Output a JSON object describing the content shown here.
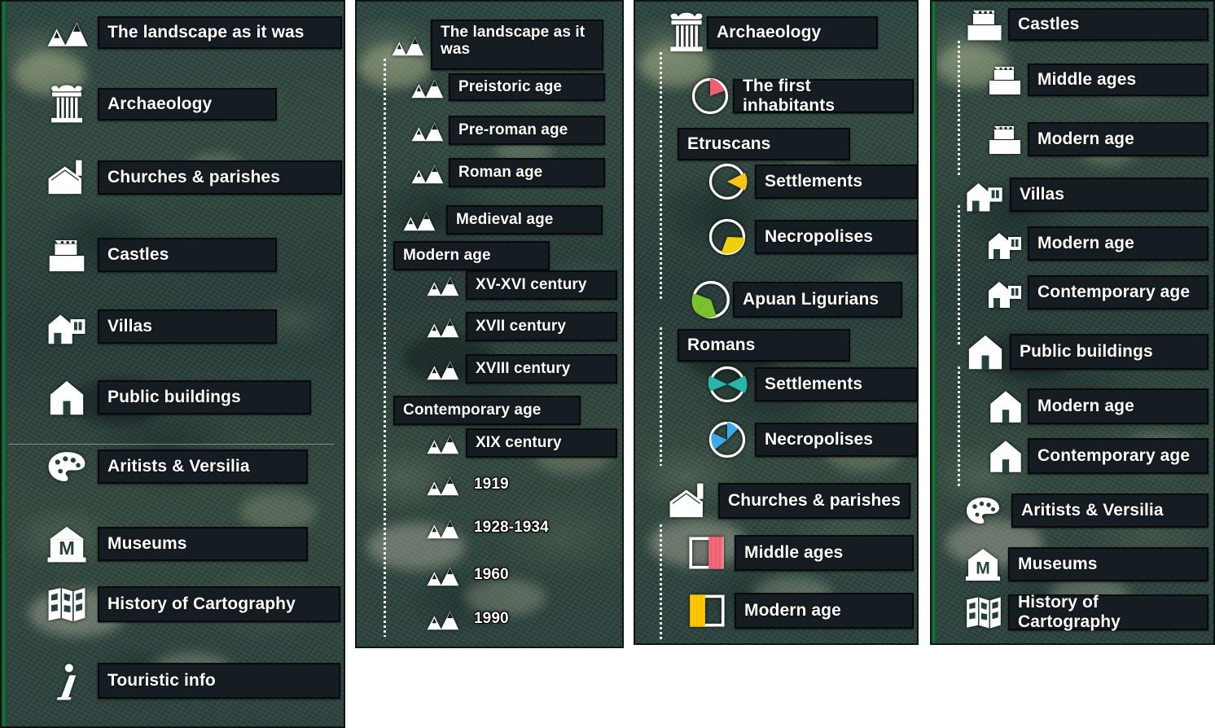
{
  "meta": {
    "title": "Thematic map legend panels",
    "panel_count": 4,
    "colors": {
      "label_background": "#161d22",
      "label_border": "#070a0c",
      "label_text": "#ffffff",
      "panel_background": "#2d4440",
      "green_edge": "#1b7a3a",
      "pie_pink": "#ef5f73",
      "pie_yellow": "#f5c518",
      "pie_yellow2": "#f0d00c",
      "pie_green": "#7ac22b",
      "pie_teal": "#26b5a6",
      "pie_blue": "#3fa9e8",
      "square_pink": "#f2697a",
      "square_yellow": "#fcc800"
    }
  },
  "panels": [
    {
      "id": "panel-main-themes",
      "name": "main-themes",
      "rows": [
        {
          "label": "The landscape as it was",
          "icon": "mountains-icon",
          "indent": 0,
          "box": true
        },
        {
          "label": "Archaeology",
          "icon": "column-icon",
          "indent": 0,
          "box": true
        },
        {
          "label": "Churches & parishes",
          "icon": "church-icon",
          "indent": 0,
          "box": true
        },
        {
          "label": "Castles",
          "icon": "castle-icon",
          "indent": 0,
          "box": true
        },
        {
          "label": "Villas",
          "icon": "villa-icon",
          "indent": 0,
          "box": true
        },
        {
          "label": "Public buildings",
          "icon": "public-building-icon",
          "indent": 0,
          "box": true
        },
        {
          "label": "Aritists & Versilia",
          "icon": "palette-icon",
          "indent": 0,
          "box": true
        },
        {
          "label": "Museums",
          "icon": "museum-icon",
          "indent": 0,
          "box": true
        },
        {
          "label": "History of Cartography",
          "icon": "map-icon",
          "indent": 0,
          "box": true
        },
        {
          "label": "Touristic info",
          "icon": "info-icon",
          "indent": 0,
          "box": true
        }
      ],
      "has_divider": true,
      "has_green_edge": true
    },
    {
      "id": "panel-landscape",
      "name": "landscape-as-it-was",
      "rows": [
        {
          "label": "The landscape as it was",
          "icon": "mountains-icon",
          "indent": 0,
          "box": true
        },
        {
          "label": "Preistoric age",
          "icon": "mountains-icon",
          "indent": 1,
          "box": true
        },
        {
          "label": "Pre-roman age",
          "icon": "mountains-icon",
          "indent": 1,
          "box": true
        },
        {
          "label": "Roman age",
          "icon": "mountains-icon",
          "indent": 1,
          "box": true
        },
        {
          "label": "Medieval age",
          "icon": "mountains-icon",
          "indent": 1,
          "box": true
        },
        {
          "label": "Modern age",
          "icon": "none",
          "indent": 0,
          "box": true
        },
        {
          "label": "XV-XVI century",
          "icon": "mountains-icon",
          "indent": 2,
          "box": true
        },
        {
          "label": "XVII century",
          "icon": "mountains-icon",
          "indent": 2,
          "box": true
        },
        {
          "label": "XVIII century",
          "icon": "mountains-icon",
          "indent": 2,
          "box": true
        },
        {
          "label": "Contemporary age",
          "icon": "none",
          "indent": 0,
          "box": true
        },
        {
          "label": "XIX century",
          "icon": "mountains-icon",
          "indent": 2,
          "box": true
        },
        {
          "label": "1919",
          "icon": "mountains-icon",
          "indent": 2,
          "box": false
        },
        {
          "label": "1928-1934",
          "icon": "mountains-icon",
          "indent": 2,
          "box": false
        },
        {
          "label": "1960",
          "icon": "mountains-icon",
          "indent": 2,
          "box": false
        },
        {
          "label": "1990",
          "icon": "mountains-icon",
          "indent": 2,
          "box": false
        }
      ],
      "has_divider": false,
      "has_green_edge": false
    },
    {
      "id": "panel-archaeology",
      "name": "archaeology",
      "rows": [
        {
          "label": "Archaeology",
          "icon": "column-icon",
          "indent": 0,
          "box": true
        },
        {
          "label": "The first inhabitants",
          "icon": "pie-pink-icon",
          "indent": 1,
          "box": true
        },
        {
          "label": "Etruscans",
          "icon": "none",
          "indent": 0,
          "box": true
        },
        {
          "label": "Settlements",
          "icon": "pie-yellow-icon",
          "indent": 2,
          "box": true
        },
        {
          "label": "Necropolises",
          "icon": "pie-yellow2-icon",
          "indent": 2,
          "box": true
        },
        {
          "label": "Apuan Ligurians",
          "icon": "pie-green-icon",
          "indent": 1,
          "box": true
        },
        {
          "label": "Romans",
          "icon": "none",
          "indent": 0,
          "box": true
        },
        {
          "label": "Settlements",
          "icon": "pie-teal-icon",
          "indent": 2,
          "box": true
        },
        {
          "label": "Necropolises",
          "icon": "pie-blue-icon",
          "indent": 2,
          "box": true
        },
        {
          "label": "Churches & parishes",
          "icon": "church-icon",
          "indent": 0,
          "box": true
        },
        {
          "label": "Middle ages",
          "icon": "square-pink-icon",
          "indent": 1,
          "box": true
        },
        {
          "label": "Modern age",
          "icon": "square-yellow-icon",
          "indent": 1,
          "box": true
        }
      ],
      "has_divider": false,
      "has_green_edge": false
    },
    {
      "id": "panel-buildings",
      "name": "buildings-and-culture",
      "rows": [
        {
          "label": "Castles",
          "icon": "castle-icon",
          "indent": 0,
          "box": true
        },
        {
          "label": "Middle ages",
          "icon": "castle-icon",
          "indent": 1,
          "box": true
        },
        {
          "label": "Modern age",
          "icon": "castle-icon",
          "indent": 1,
          "box": true
        },
        {
          "label": "Villas",
          "icon": "villa-icon",
          "indent": 0,
          "box": true
        },
        {
          "label": "Modern age",
          "icon": "villa-icon",
          "indent": 1,
          "box": true
        },
        {
          "label": "Contemporary age",
          "icon": "villa-icon",
          "indent": 1,
          "box": true
        },
        {
          "label": "Public buildings",
          "icon": "public-building-icon",
          "indent": 0,
          "box": true
        },
        {
          "label": "Modern age",
          "icon": "public-building-icon",
          "indent": 1,
          "box": true
        },
        {
          "label": "Contemporary age",
          "icon": "public-building-icon",
          "indent": 1,
          "box": true
        },
        {
          "label": "Aritists & Versilia",
          "icon": "palette-icon",
          "indent": 0,
          "box": true
        },
        {
          "label": "Museums",
          "icon": "museum-icon",
          "indent": 0,
          "box": true
        },
        {
          "label": "History of Cartography",
          "icon": "map-icon",
          "indent": 0,
          "box": true
        }
      ],
      "has_divider": false,
      "has_green_edge": true
    }
  ]
}
